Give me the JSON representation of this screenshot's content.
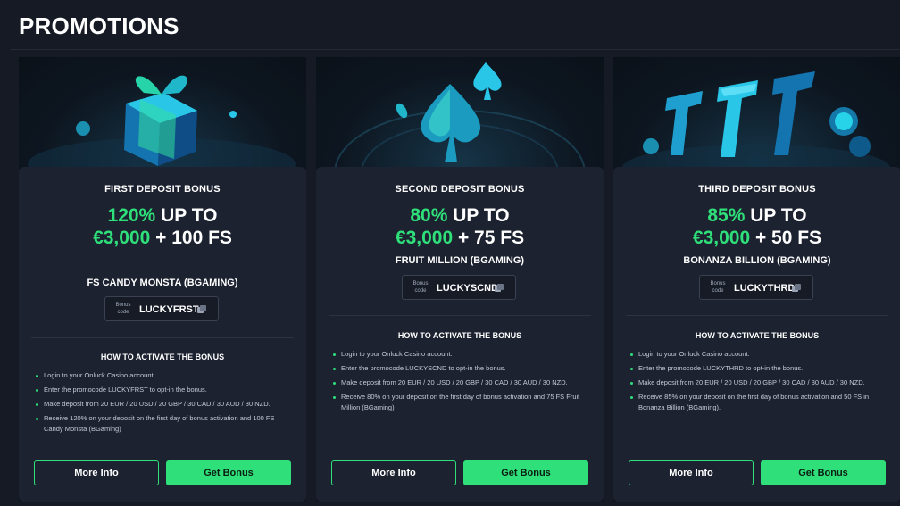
{
  "page": {
    "title": "PROMOTIONS"
  },
  "cards": [
    {
      "heading": "FIRST DEPOSIT BONUS",
      "offer_pct": "120%",
      "offer_upto": " UP TO",
      "offer_amount": "€3,000",
      "offer_rest": " + 100 FS",
      "game": "FS CANDY MONSTA (BGAMING)",
      "code_label": "Bonus code",
      "code": "LUCKYFRST",
      "how_title": "HOW TO ACTIVATE THE BONUS",
      "steps": [
        "Login to your Onluck Casino account.",
        "Enter the promocode LUCKYFRST to opt-in the bonus.",
        "Make deposit from 20 EUR / 20 USD / 20 GBP / 30 CAD / 30 AUD / 30 NZD.",
        "Receive 120% on your deposit on the first day of bonus activation and 100 FS Candy Monsta (BGaming)"
      ],
      "more_label": "More Info",
      "get_label": "Get Bonus",
      "hero_icon": "gift-box-icon"
    },
    {
      "heading": "SECOND DEPOSIT BONUS",
      "offer_pct": "80%",
      "offer_upto": " UP TO",
      "offer_amount": "€3,000",
      "offer_rest": " + 75 FS",
      "game": "FRUIT MILLION (BGAMING)",
      "code_label": "Bonus code",
      "code": "LUCKYSCND",
      "how_title": "HOW TO ACTIVATE THE BONUS",
      "steps": [
        "Login to your Onluck Casino account.",
        "Enter the promocode LUCKYSCND to opt-in the bonus.",
        "Make deposit from 20 EUR / 20 USD / 20 GBP / 30 CAD / 30 AUD / 30 NZD.",
        "Receive 80% on your deposit on the first day of bonus activation and 75 FS Fruit Million (BGaming)"
      ],
      "more_label": "More Info",
      "get_label": "Get Bonus",
      "hero_icon": "spade-icon"
    },
    {
      "heading": "THIRD DEPOSIT BONUS",
      "offer_pct": "85%",
      "offer_upto": " UP TO",
      "offer_amount": "€3,000",
      "offer_rest": " + 50 FS",
      "game": "BONANZA BILLION (BGAMING)",
      "code_label": "Bonus code",
      "code": "LUCKYTHRD",
      "how_title": "HOW TO ACTIVATE THE BONUS",
      "steps": [
        "Login to your Onluck Casino account.",
        "Enter the promocode LUCKYTHRD to opt-in the bonus.",
        "Make deposit from 20 EUR / 20 USD / 20 GBP / 30 CAD / 30 AUD / 30 NZD.",
        "Receive 85% on your deposit on the first day of bonus activation and 50 FS in Bonanza Billion (BGaming)."
      ],
      "more_label": "More Info",
      "get_label": "Get Bonus",
      "hero_icon": "lucky-777-icon"
    }
  ],
  "colors": {
    "accent": "#2fe07a",
    "card_bg": "#1c2230",
    "page_bg": "#151a24"
  }
}
